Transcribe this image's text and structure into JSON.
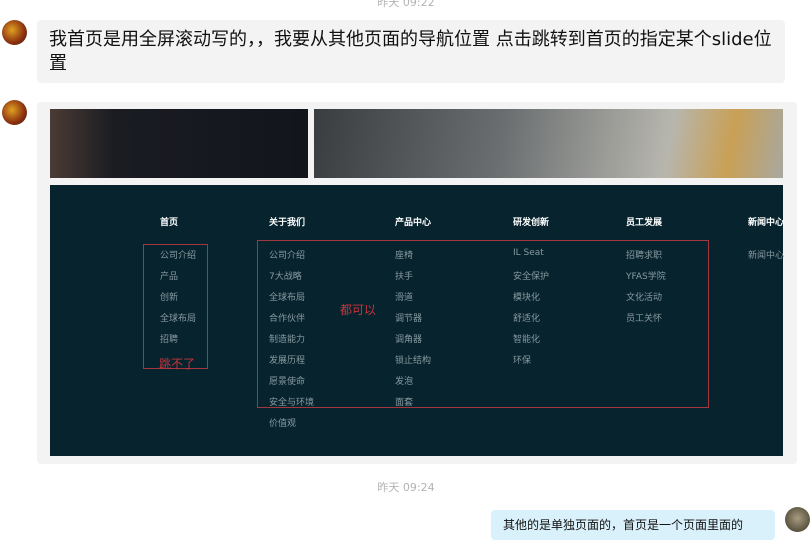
{
  "timestamps": [
    "昨天 09:22",
    "昨天 09:24"
  ],
  "messages": {
    "first": "我首页是用全屏滚动写的，，我要从其他页面的导航位置 点击跳转到首页的指定某个slide位置",
    "reply": "其他的是单独页面的，首页是一个页面里面的"
  },
  "nav": [
    {
      "title": "首页",
      "items": [
        "公司介绍",
        "产品",
        "创新",
        "全球布局",
        "招聘"
      ]
    },
    {
      "title": "关于我们",
      "items": [
        "公司介绍",
        "7大战略",
        "全球布局",
        "合作伙伴",
        "制造能力",
        "发展历程",
        "愿景使命",
        "安全与环境",
        "价值观"
      ]
    },
    {
      "title": "产品中心",
      "items": [
        "座椅",
        "扶手",
        "滑道",
        "调节器",
        "调角器",
        "锁止结构",
        "发泡",
        "面套"
      ]
    },
    {
      "title": "研发创新",
      "items": [
        "IL Seat",
        "安全保护",
        "模块化",
        "舒适化",
        "智能化",
        "环保"
      ]
    },
    {
      "title": "员工发展",
      "items": [
        "招聘求职",
        "YFAS学院",
        "文化活动",
        "员工关怀"
      ]
    },
    {
      "title": "新闻中心",
      "items": [
        "新闻中心"
      ]
    }
  ],
  "annotations": {
    "cannot": "跳不了",
    "can": "都可以"
  },
  "colors": {
    "panel": "#06232e",
    "annotation": "#c8343c",
    "reply_bubble": "#d9f1fb"
  }
}
